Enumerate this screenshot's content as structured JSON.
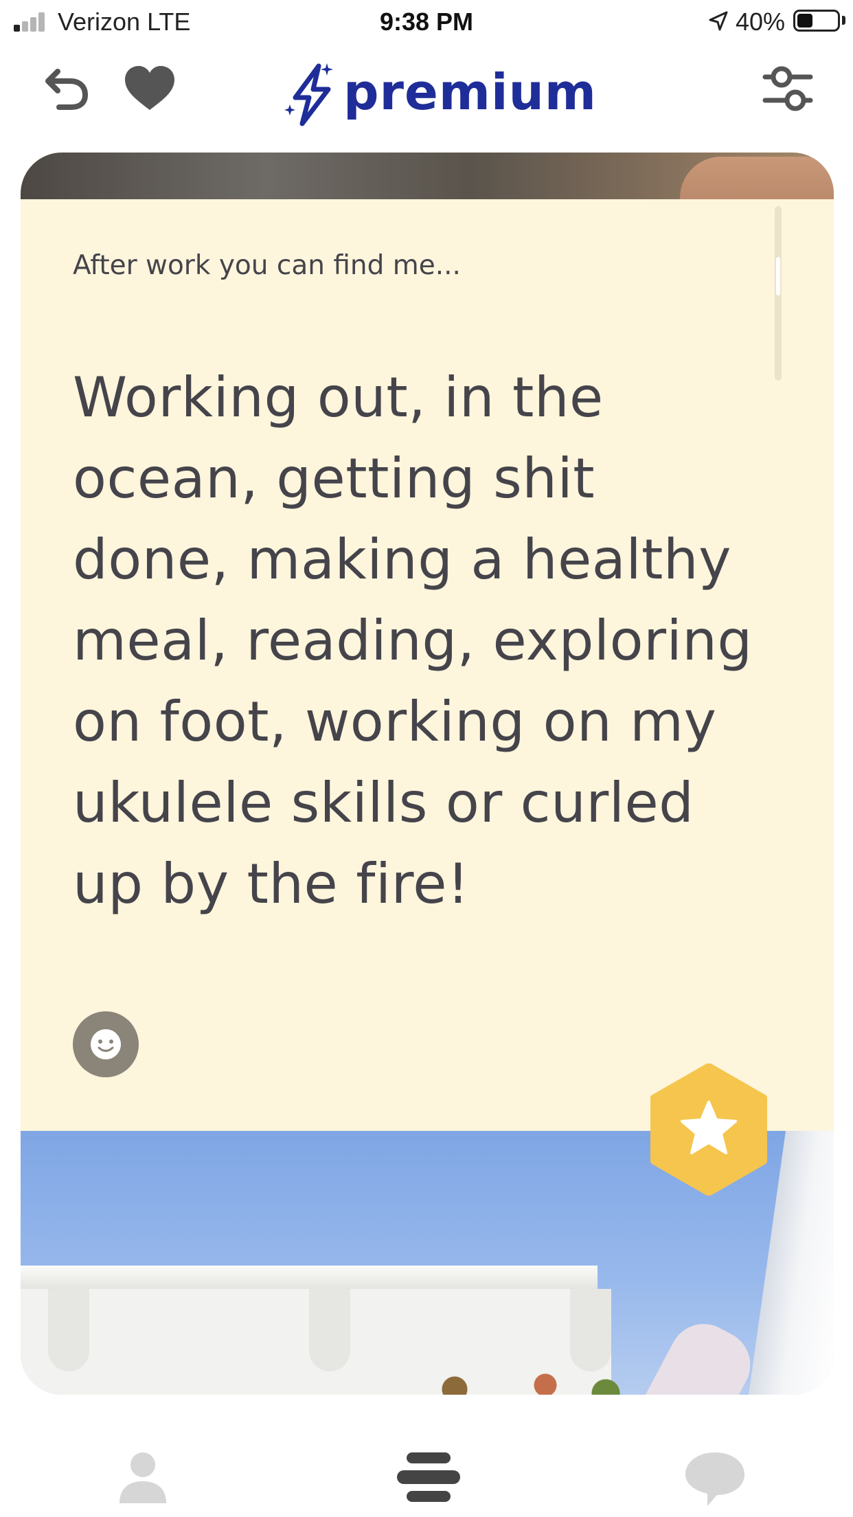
{
  "status_bar": {
    "carrier": "Verizon  LTE",
    "time": "9:38 PM",
    "battery_percent": "40%",
    "battery_level": 0.4,
    "signal_bars_filled": 1
  },
  "nav": {
    "brand_text": "premium",
    "brand_color": "#1f2d99",
    "icons": [
      "undo-icon",
      "heart-icon",
      "sliders-icon"
    ]
  },
  "card": {
    "prompt_question": "After work you can find me...",
    "prompt_answer_lines": [
      "Working out, in the",
      "ocean, getting shit",
      "done, making a healthy",
      "meal, reading, exploring",
      "on foot, working on my",
      "ukulele skills or curled",
      "up by the fire!"
    ],
    "panel_color": "#fdf5dc",
    "text_color": "#45444b",
    "superlike_color": "#f5c54e",
    "react_icon": "smiley-icon"
  },
  "tab_bar": {
    "tabs": [
      "profile-icon",
      "discover-icon",
      "messages-icon"
    ]
  }
}
